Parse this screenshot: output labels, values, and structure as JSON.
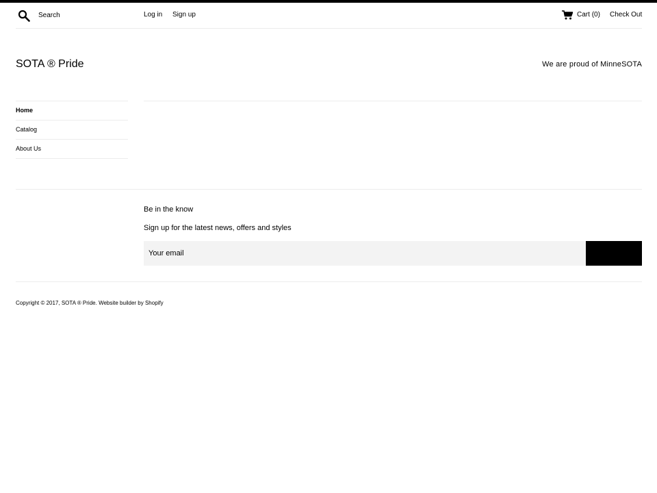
{
  "header": {
    "search": {
      "placeholder": "Search",
      "icon": "search-icon"
    },
    "login_label": "Log in",
    "signup_label": "Sign up",
    "cart": {
      "icon": "cart-icon",
      "label": "Cart",
      "count": "(0)"
    },
    "checkout_label": "Check Out"
  },
  "brand": {
    "logo_text": "SOTA ® Pride",
    "tagline": "We are proud of MinneSOTA"
  },
  "sidebar": {
    "items": [
      {
        "label": "Home",
        "active": true
      },
      {
        "label": "Catalog",
        "active": false
      },
      {
        "label": "About Us",
        "active": false
      }
    ]
  },
  "newsletter": {
    "title": "Be in the know",
    "subtitle": "Sign up for the latest news, offers and styles",
    "email_placeholder": "Your email",
    "submit_label": ""
  },
  "footer": {
    "copyright_prefix": "Copyright © 2017,",
    "shop_link": "SOTA ® Pride",
    "separator": ".",
    "builder_link": "Website builder by Shopify"
  },
  "colors": {
    "text": "#000000",
    "divider": "#ececec",
    "input_bg": "#f3f3f3",
    "button_bg": "#000000"
  }
}
